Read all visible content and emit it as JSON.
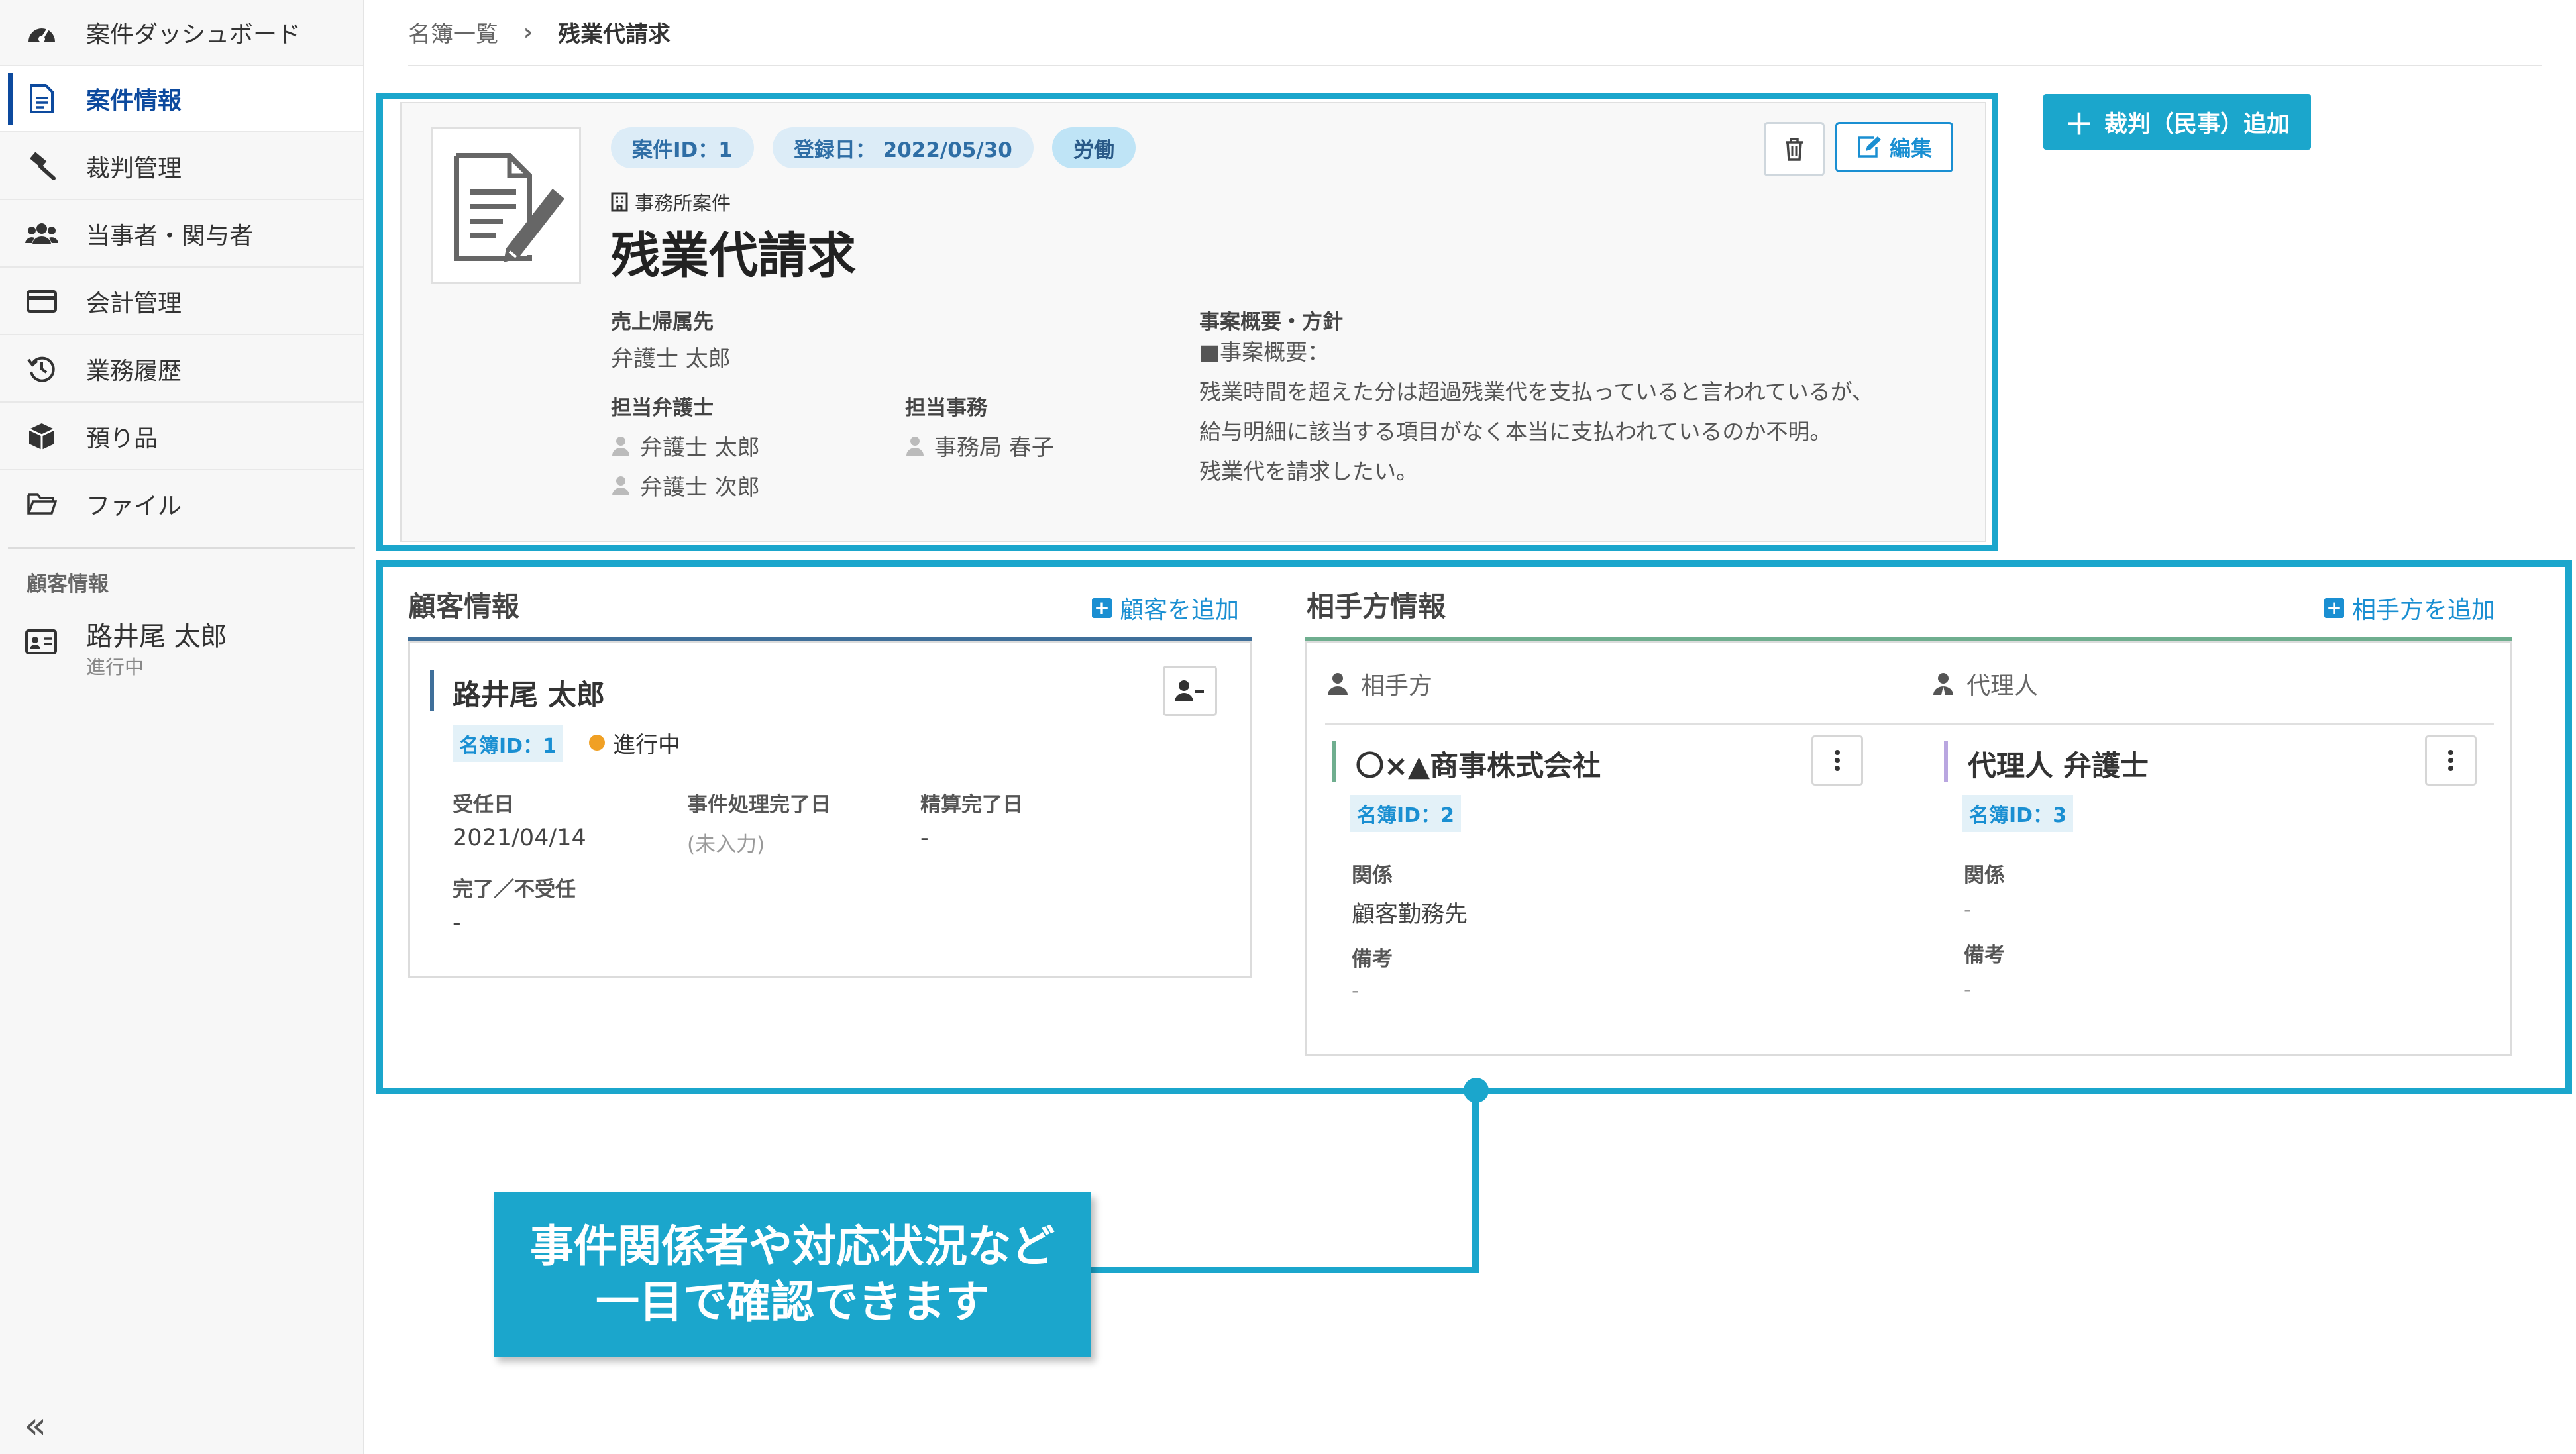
{
  "sidebar": {
    "items": [
      {
        "label": "案件ダッシュボード",
        "icon": "dashboard-icon"
      },
      {
        "label": "案件情報",
        "icon": "document-icon"
      },
      {
        "label": "裁判管理",
        "icon": "gavel-icon"
      },
      {
        "label": "当事者・関与者",
        "icon": "people-icon"
      },
      {
        "label": "会計管理",
        "icon": "card-icon"
      },
      {
        "label": "業務履歴",
        "icon": "history-icon"
      },
      {
        "label": "預り品",
        "icon": "box-icon"
      },
      {
        "label": "ファイル",
        "icon": "folder-icon"
      }
    ],
    "section_label": "顧客情報",
    "client": {
      "name": "路井尾 太郎",
      "status": "進行中"
    },
    "collapse_label": "«"
  },
  "breadcrumb": {
    "parent": "名簿一覧",
    "separator": "›",
    "current": "残業代請求"
  },
  "case": {
    "id_chip": "案件ID：1",
    "registered_chip": "登録日： 2022/05/30",
    "category_chip": "労働",
    "office_tag": "事務所案件",
    "title": "残業代請求",
    "edit_label": "編集",
    "sales_label": "売上帰属先",
    "sales_value": "弁護士 太郎",
    "lawyer_label": "担当弁護士",
    "lawyers": [
      "弁護士 太郎",
      "弁護士 次郎"
    ],
    "staff_label": "担当事務",
    "staff": [
      "事務局 春子"
    ],
    "summary_label": "事案概要・方針",
    "summary_lines": [
      "■事案概要：",
      "残業時間を超えた分は超過残業代を支払っていると言われているが、",
      "給与明細に該当する項目がなく本当に支払われているのか不明。",
      "残業代を請求したい。"
    ]
  },
  "add_trial_label": "裁判（民事）追加",
  "client_panel": {
    "title": "顧客情報",
    "add_label": "顧客を追加",
    "name": "路井尾 太郎",
    "id_chip": "名簿ID：1",
    "status": "進行中",
    "fields": {
      "accept_label": "受任日",
      "accept_value": "2021/04/14",
      "done_label": "事件処理完了日",
      "done_value": "(未入力)",
      "settle_label": "精算完了日",
      "settle_value": "-",
      "result_label": "完了／不受任",
      "result_value": "-"
    }
  },
  "opponent_panel": {
    "title": "相手方情報",
    "add_label": "相手方を追加",
    "col_opponent": "相手方",
    "col_agent": "代理人",
    "opponent": {
      "name": "〇×▲商事株式会社",
      "id_chip": "名簿ID：2",
      "relation_label": "関係",
      "relation_value": "顧客勤務先",
      "note_label": "備考",
      "note_value": "-"
    },
    "agent": {
      "name": "代理人 弁護士",
      "id_chip": "名簿ID：3",
      "relation_label": "関係",
      "relation_value": "-",
      "note_label": "備考",
      "note_value": "-"
    }
  },
  "callout": {
    "line1": "事件関係者や対応状況など",
    "line2": "一目で確認できます"
  },
  "colors": {
    "accent": "#1ba6cc",
    "primary": "#0d4a9e",
    "link": "#1a8fd2",
    "status_dot": "#f0a024",
    "client_bar": "#3f6f9a",
    "opponent_bar": "#6fae8f",
    "agent_bar": "#b9a6e0"
  }
}
